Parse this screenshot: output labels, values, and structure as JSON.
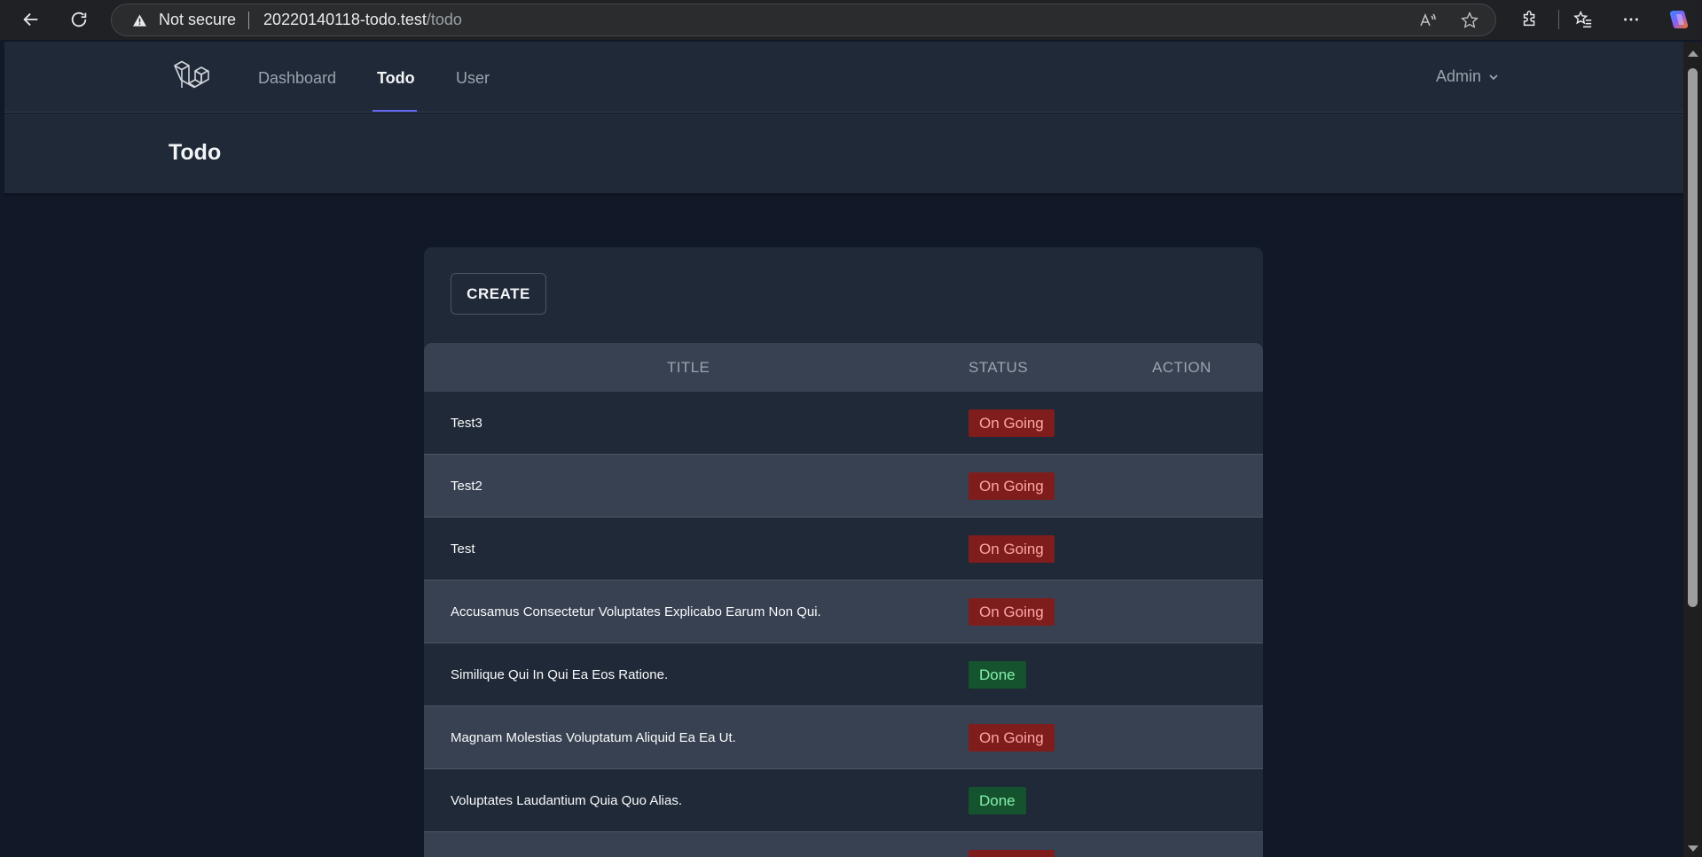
{
  "browser": {
    "security_label": "Not secure",
    "url_host": "20220140118-todo.test",
    "url_path": "/todo",
    "icons": [
      "back-icon",
      "reload-icon",
      "warning-icon",
      "read-aloud-icon",
      "favorite-star-icon",
      "extensions-icon",
      "favorites-icon",
      "more-icon",
      "copilot-icon"
    ]
  },
  "nav": {
    "items": [
      {
        "label": "Dashboard",
        "active": false
      },
      {
        "label": "Todo",
        "active": true
      },
      {
        "label": "User",
        "active": false
      }
    ],
    "user_menu": "Admin"
  },
  "header": {
    "title": "Todo"
  },
  "todo": {
    "create_label": "CREATE",
    "columns": [
      "TITLE",
      "STATUS",
      "ACTION"
    ],
    "rows": [
      {
        "title": "Test3",
        "status": "On Going"
      },
      {
        "title": "Test2",
        "status": "On Going"
      },
      {
        "title": "Test",
        "status": "On Going"
      },
      {
        "title": "Accusamus Consectetur Voluptates Explicabo Earum Non Qui.",
        "status": "On Going"
      },
      {
        "title": "Similique Qui In Qui Ea Eos Ratione.",
        "status": "Done"
      },
      {
        "title": "Magnam Molestias Voluptatum Aliquid Ea Ea Ut.",
        "status": "On Going"
      },
      {
        "title": "Voluptates Laudantium Quia Quo Alias.",
        "status": "Done"
      },
      {
        "title": "",
        "status": "On Going"
      }
    ]
  },
  "colors": {
    "page_bg": "#111827",
    "surface": "#1f2937",
    "row_alt": "#374151",
    "accent": "#6366f1",
    "ongoing_bg": "#7f1d1d",
    "ongoing_text": "#fca5a5",
    "done_bg": "#14532d",
    "done_text": "#86efac"
  }
}
